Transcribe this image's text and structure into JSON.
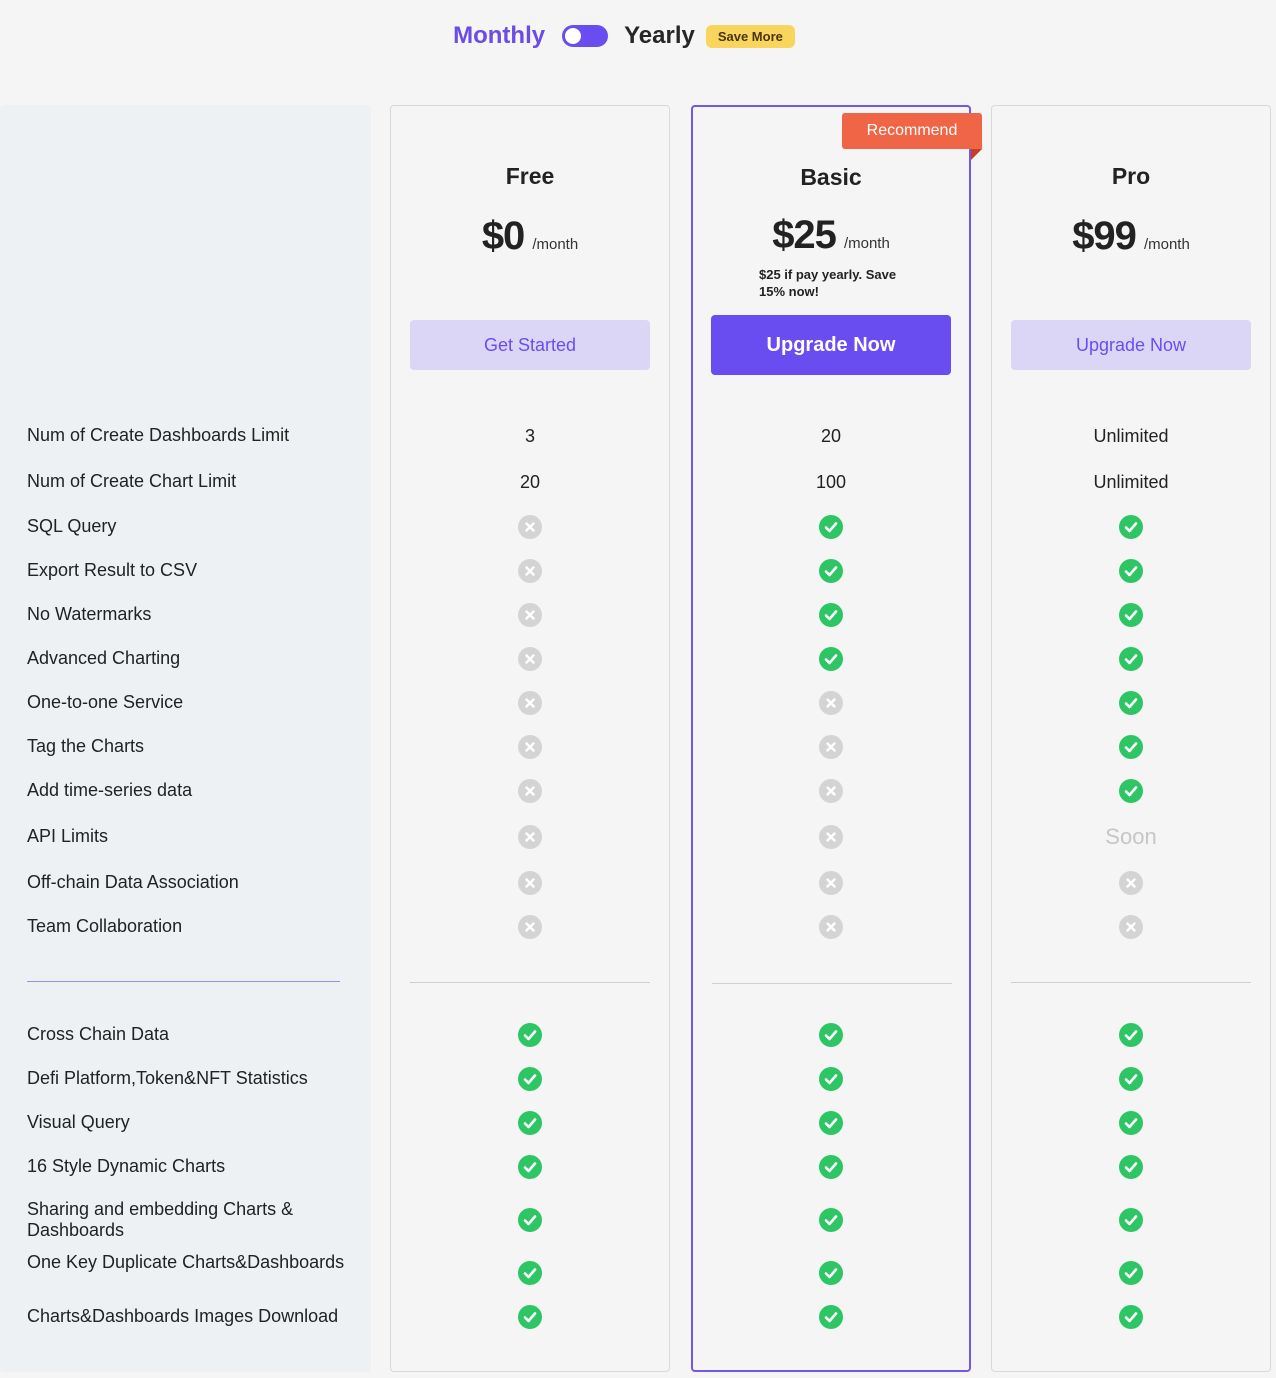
{
  "billing": {
    "monthly_label": "Monthly",
    "yearly_label": "Yearly",
    "save_badge": "Save More",
    "toggle_state": "monthly"
  },
  "colors": {
    "accent": "#6a4df0",
    "ok": "#2ec665",
    "no": "#d4d4d4",
    "ribbon": "#f06545",
    "badge": "#f8d55c"
  },
  "plans": [
    {
      "name": "Free",
      "price": "$0",
      "period": "/month",
      "note": "",
      "cta": "Get Started",
      "recommended": false,
      "limits": [
        "3",
        "20"
      ],
      "features": [
        "no",
        "no",
        "no",
        "no",
        "no",
        "no",
        "no",
        "no",
        "no",
        "no"
      ],
      "extras": [
        "ok",
        "ok",
        "ok",
        "ok",
        "ok",
        "ok",
        "ok"
      ]
    },
    {
      "name": "Basic",
      "price": "$25",
      "period": "/month",
      "note": "$25 if pay yearly. Save 15% now!",
      "cta": "Upgrade Now",
      "recommended": true,
      "ribbon": "Recommend",
      "limits": [
        "20",
        "100"
      ],
      "features": [
        "ok",
        "ok",
        "ok",
        "ok",
        "no",
        "no",
        "no",
        "no",
        "no",
        "no"
      ],
      "extras": [
        "ok",
        "ok",
        "ok",
        "ok",
        "ok",
        "ok",
        "ok"
      ]
    },
    {
      "name": "Pro",
      "price": "$99",
      "period": "/month",
      "note": "",
      "cta": "Upgrade Now",
      "recommended": false,
      "limits": [
        "Unlimited",
        "Unlimited"
      ],
      "features": [
        "ok",
        "ok",
        "ok",
        "ok",
        "ok",
        "ok",
        "ok",
        "Soon",
        "no",
        "no"
      ],
      "extras": [
        "ok",
        "ok",
        "ok",
        "ok",
        "ok",
        "ok",
        "ok"
      ]
    }
  ],
  "feature_labels": {
    "limits": [
      "Num of Create Dashboards Limit",
      "Num of Create Chart Limit"
    ],
    "features": [
      "SQL Query",
      "Export Result to CSV",
      "No Watermarks",
      "Advanced Charting",
      "One-to-one Service",
      "Tag the Charts",
      "Add time-series data",
      "API Limits",
      "Off-chain Data Association",
      "Team Collaboration"
    ],
    "extras": [
      "Cross Chain Data",
      "Defi Platform,Token&NFT Statistics",
      "Visual Query",
      "16 Style Dynamic Charts",
      "Sharing and embedding Charts & Dashboards",
      "One Key Duplicate Charts&Dashboards",
      "Charts&Dashboards Images Download"
    ]
  }
}
